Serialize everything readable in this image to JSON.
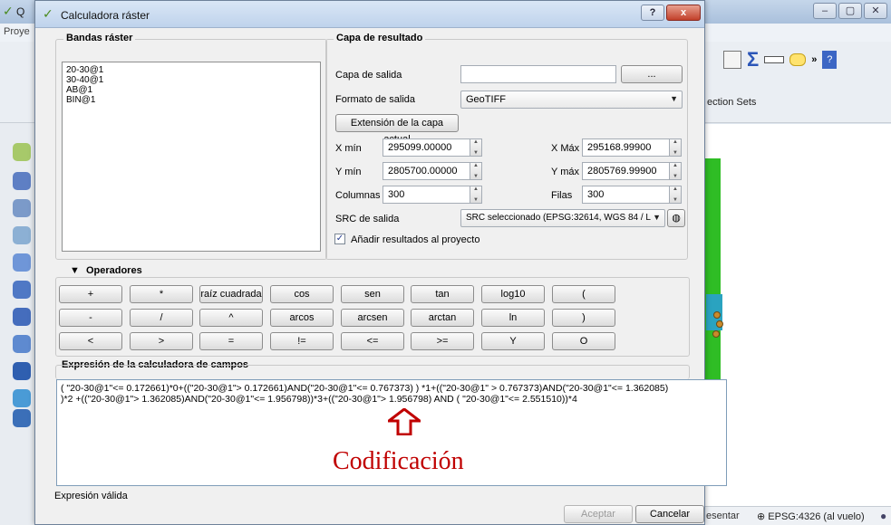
{
  "background_window": {
    "title": "Q",
    "menu_first": "Proye",
    "selection_sets": "ection Sets",
    "status_left": "esentar",
    "status_crs": "EPSG:4326 (al vuelo)"
  },
  "dialog": {
    "title": "Calculadora ráster",
    "help_label": "?",
    "close_label": "x"
  },
  "bands": {
    "title": "Bandas ráster",
    "items": [
      "20-30@1",
      "30-40@1",
      "AB@1",
      "BIN@1"
    ]
  },
  "result": {
    "title": "Capa de resultado",
    "output_layer_label": "Capa de salida",
    "output_layer_value": "",
    "browse_label": "...",
    "format_label": "Formato de salida",
    "format_value": "GeoTIFF",
    "extent_button": "Extensión de la capa actual",
    "xmin_label": "X mín",
    "xmin_value": "295099.00000",
    "xmax_label": "X Máx",
    "xmax_value": "295168.99900",
    "ymin_label": "Y mín",
    "ymin_value": "2805700.00000",
    "ymax_label": "Y máx",
    "ymax_value": "2805769.99900",
    "cols_label": "Columnas",
    "cols_value": "300",
    "rows_label": "Filas",
    "rows_value": "300",
    "crs_label": "SRC de salida",
    "crs_value": "SRC seleccionado (EPSG:32614, WGS 84 / L",
    "add_to_project_label": "Añadir resultados al proyecto",
    "add_to_project_checked": true
  },
  "operators": {
    "title": "Operadores",
    "rows": [
      [
        "+",
        "*",
        "raíz cuadrada",
        "cos",
        "sen",
        "tan",
        "log10",
        "("
      ],
      [
        "-",
        "/",
        "^",
        "arcos",
        "arcsen",
        "arctan",
        "ln",
        ")"
      ],
      [
        "<",
        ">",
        "=",
        "!=",
        "<=",
        ">=",
        "Y",
        "O"
      ]
    ]
  },
  "expression": {
    "title": "Expresión de la calculadora de campos",
    "line1": "( \"20-30@1\"<= 0.172661)*0+((\"20-30@1\"> 0.172661)AND(\"20-30@1\"<= 0.767373) ) *1+((\"20-30@1\" > 0.767373)AND(\"20-30@1\"<= 1.362085)",
    "line2": ")*2 +((\"20-30@1\"> 1.362085)AND(\"20-30@1\"<= 1.956798))*3+((\"20-30@1\"> 1.956798) AND ( \"20-30@1\"<= 2.551510))*4",
    "annotation": "Codificación",
    "status": "Expresión válida"
  },
  "footer": {
    "ok_label": "Aceptar",
    "cancel_label": "Cancelar"
  },
  "colors": {
    "annotation_red": "#c00000",
    "map_green": "#2fbd25"
  }
}
